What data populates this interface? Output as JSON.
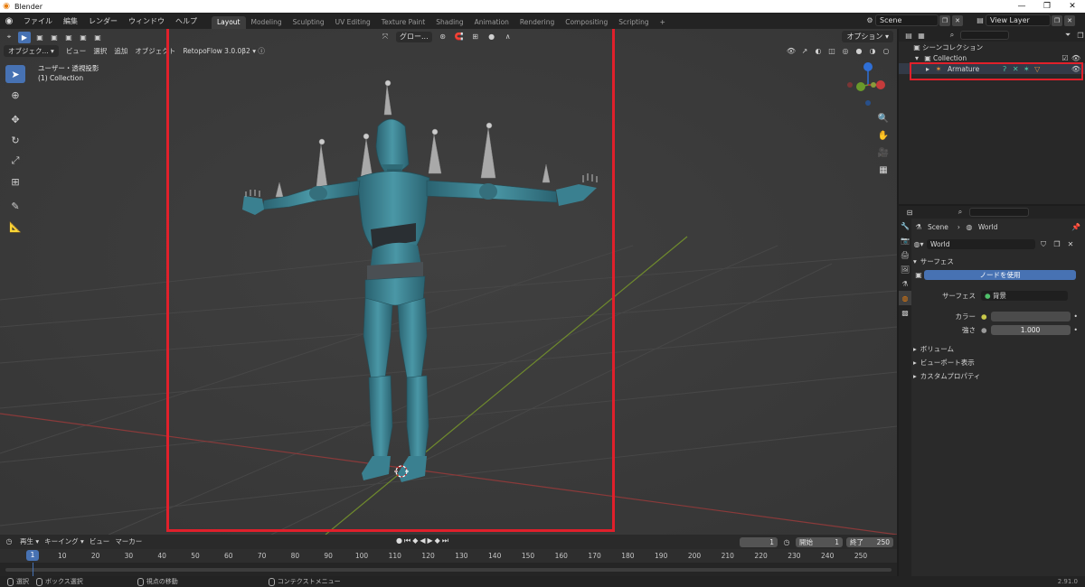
{
  "window": {
    "title": "Blender",
    "controls": [
      "—",
      "❐",
      "✕"
    ]
  },
  "menu": [
    "ファイル",
    "編集",
    "レンダー",
    "ウィンドウ",
    "ヘルプ"
  ],
  "workspaces": [
    "Layout",
    "Modeling",
    "Sculpting",
    "UV Editing",
    "Texture Paint",
    "Shading",
    "Animation",
    "Rendering",
    "Compositing",
    "Scripting"
  ],
  "active_workspace": "Layout",
  "scene": {
    "name": "Scene",
    "view_layer": "View Layer"
  },
  "viewport": {
    "mode": "オブジェク...",
    "menus": [
      "ビュー",
      "選択",
      "追加",
      "オブジェクト"
    ],
    "addon": "RetopoFlow 3.0.0β2",
    "transform_orientation": "グロー...",
    "option_label": "オプション",
    "info_line1": "ユーザー・透視投影",
    "info_line2": "(1) Collection",
    "model_color": "#3b7f8c",
    "highlight_color": "#e0202b"
  },
  "timeline": {
    "menus": [
      "再生",
      "キーイング",
      "ビュー",
      "マーカー"
    ],
    "current_frame": "1",
    "start_label": "開始",
    "start": "1",
    "end_label": "終了",
    "end": "250",
    "ruler_ticks": [
      "1",
      "10",
      "20",
      "30",
      "40",
      "50",
      "60",
      "70",
      "80",
      "90",
      "100",
      "110",
      "120",
      "130",
      "140",
      "150",
      "160",
      "170",
      "180",
      "190",
      "200",
      "210",
      "220",
      "230",
      "240",
      "250"
    ]
  },
  "status": {
    "select": "選択",
    "box_select": "ボックス選択",
    "rotate_view": "視点の移動",
    "context_menu": "コンテクストメニュー",
    "version": "2.91.0"
  },
  "outliner": {
    "scene_collection": "シーンコレクション",
    "collection": "Collection",
    "armature": "Armature"
  },
  "properties": {
    "breadcrumb_scene": "Scene",
    "breadcrumb_world": "World",
    "world_name": "World",
    "surface_panel": "サーフェス",
    "use_nodes": "ノードを使用",
    "surface_label": "サーフェス",
    "surface_value": "背景",
    "color_label": "カラー",
    "strength_label": "強さ",
    "strength_value": "1.000",
    "volume_panel": "ボリューム",
    "viewport_display_panel": "ビューポート表示",
    "custom_props_panel": "カスタムプロパティ"
  }
}
